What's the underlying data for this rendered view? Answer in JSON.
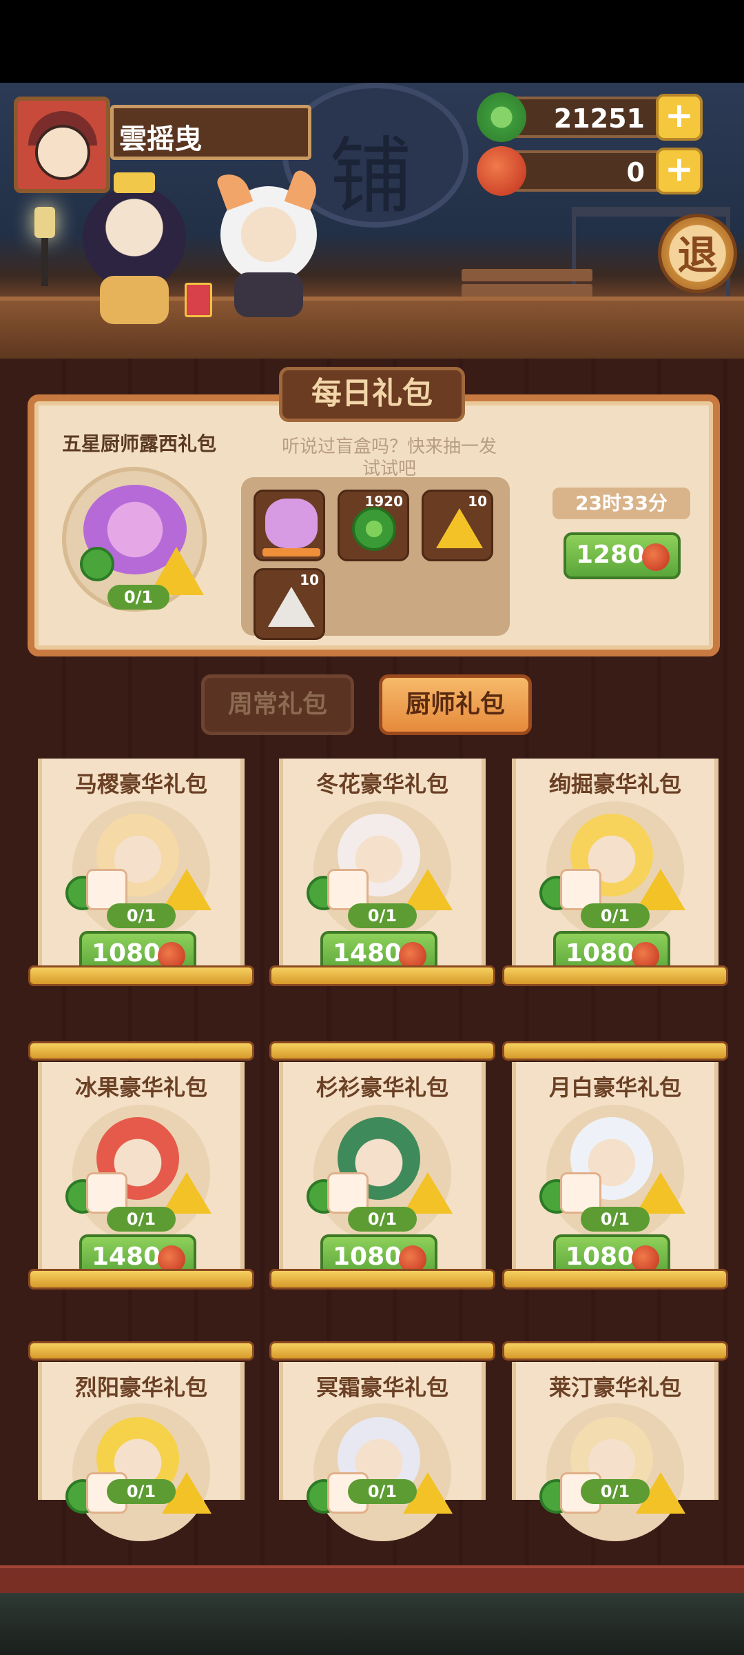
{
  "player": {
    "name": "雲摇曳"
  },
  "currencies": [
    {
      "icon": "jade-coin-icon",
      "value": "21251"
    },
    {
      "icon": "red-apple-icon",
      "value": "0"
    }
  ],
  "exit_label": "退",
  "daily": {
    "title": "每日礼包",
    "pack_name": "五星厨师露西礼包",
    "tease": "听说过盲盒吗？快来抽一发试试吧",
    "count": "0/1",
    "items": [
      {
        "icon": "cat-chef-icon",
        "qty": ""
      },
      {
        "icon": "jade-coin-icon",
        "qty": "1920"
      },
      {
        "icon": "gold-token-icon",
        "qty": "10"
      },
      {
        "icon": "silver-token-icon",
        "qty": "10"
      }
    ],
    "timer": "23时33分",
    "price": "1280"
  },
  "tabs": {
    "weekly": "周常礼包",
    "chef": "厨师礼包"
  },
  "cards": [
    {
      "title": "马稷豪华礼包",
      "count": "0/1",
      "price": "1080",
      "color": "#f5d9a6"
    },
    {
      "title": "冬花豪华礼包",
      "count": "0/1",
      "price": "1480",
      "color": "#f4ecea"
    },
    {
      "title": "绚掘豪华礼包",
      "count": "0/1",
      "price": "1080",
      "color": "#f7d35b"
    },
    {
      "title": "冰果豪华礼包",
      "count": "0/1",
      "price": "1480",
      "color": "#e55a4a"
    },
    {
      "title": "杉衫豪华礼包",
      "count": "0/1",
      "price": "1080",
      "color": "#3f8a5a"
    },
    {
      "title": "月白豪华礼包",
      "count": "0/1",
      "price": "1080",
      "color": "#eef2f8"
    },
    {
      "title": "烈阳豪华礼包",
      "count": "0/1",
      "price": "",
      "color": "#f6d24a"
    },
    {
      "title": "冥霜豪华礼包",
      "count": "0/1",
      "price": "",
      "color": "#e8e8f2"
    },
    {
      "title": "莱汀豪华礼包",
      "count": "0/1",
      "price": "",
      "color": "#f2dcb0"
    }
  ]
}
